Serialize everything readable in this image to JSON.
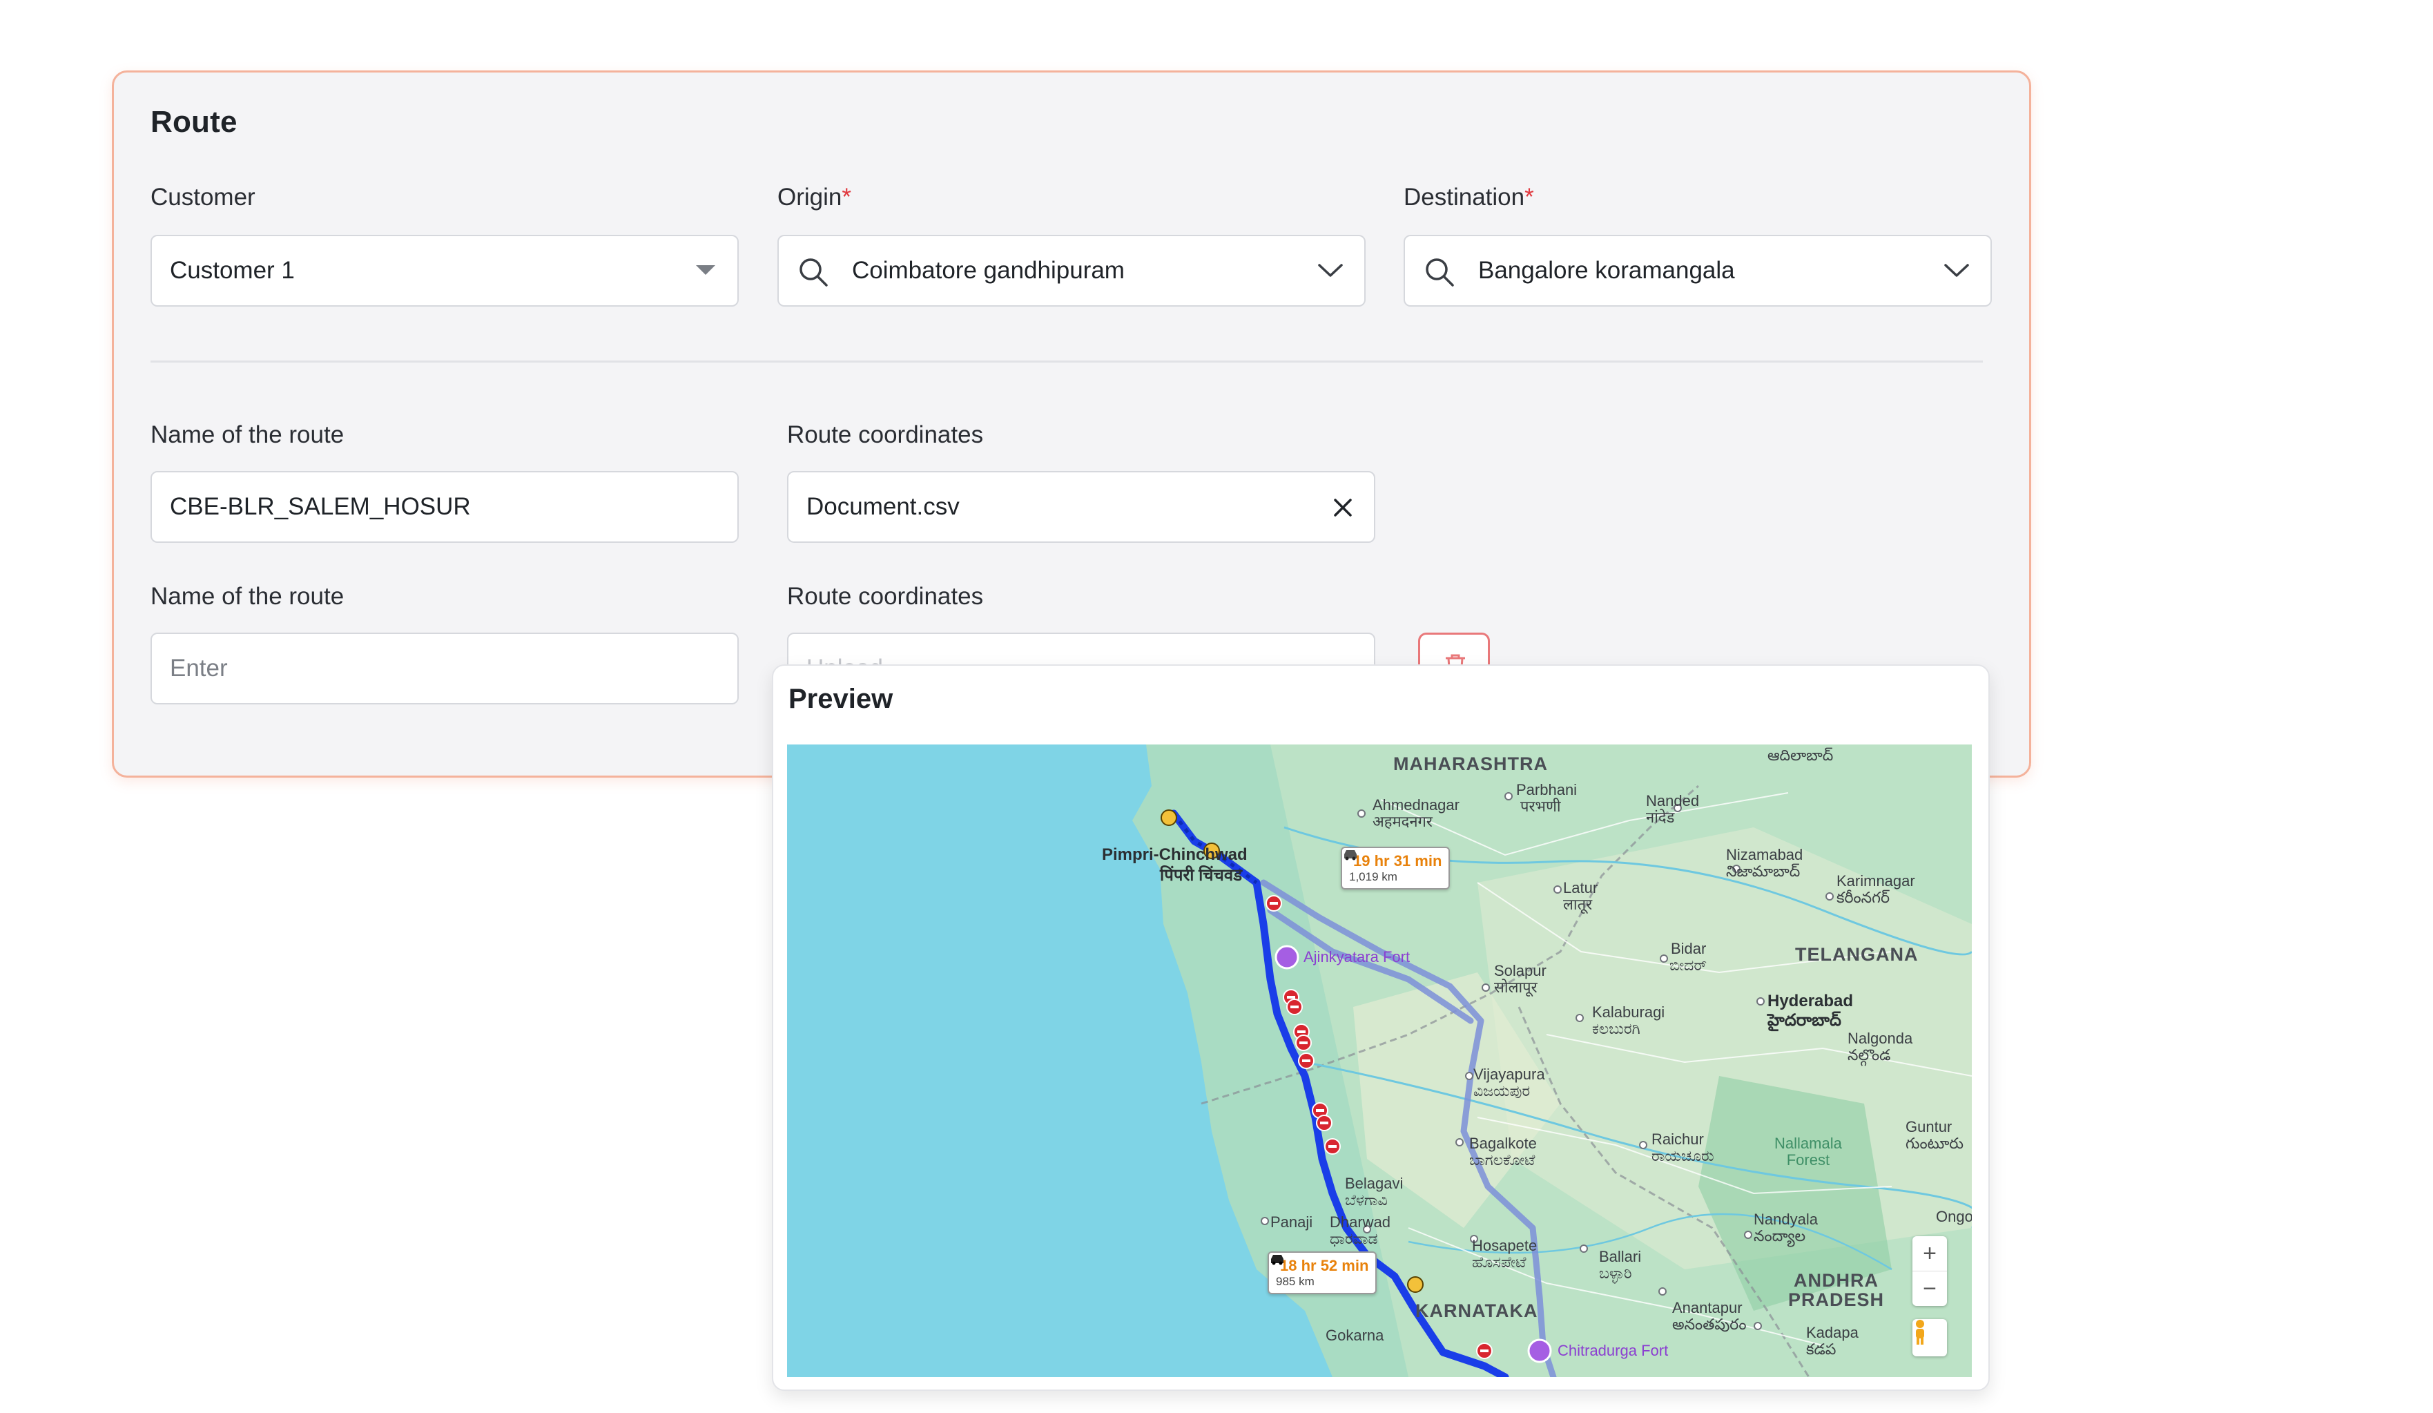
{
  "section_title": "Route",
  "customer": {
    "label": "Customer",
    "value": "Customer 1"
  },
  "origin": {
    "label": "Origin",
    "required_mark": "*",
    "value": "Coimbatore gandhipuram"
  },
  "destination": {
    "label": "Destination",
    "required_mark": "*",
    "value": "Bangalore koramangala"
  },
  "route_row_1": {
    "name_label": "Name of the route",
    "name_value": "CBE-BLR_SALEM_HOSUR",
    "coords_label": "Route coordinates",
    "coords_value": "Document.csv"
  },
  "route_row_2": {
    "name_label": "Name of the route",
    "name_placeholder": "Enter",
    "coords_label": "Route coordinates",
    "coords_placeholder": "Upload"
  },
  "preview": {
    "title": "Preview",
    "map": {
      "route_options": [
        {
          "time": "19 hr 31 min",
          "distance": "1,019 km"
        },
        {
          "time": "18 hr 52 min",
          "distance": "985 km"
        }
      ],
      "labels": {
        "maharashtra": "MAHARASHTRA",
        "karnataka": "KARNATAKA",
        "telangana": "TELANGANA",
        "andhra_pradesh": "ANDHRA\nPRADESH",
        "pimpri": "Pimpri-Chinchwad",
        "pimpri_local": "पिंपरी चिंचवड",
        "ahmednagar": "Ahmednagar",
        "ahmednagar_local": "अहमदनगर",
        "parbhani": "Parbhani",
        "parbhani_local": "परभणी",
        "nanded": "Nanded",
        "nanded_local": "नांदेड",
        "nizamabad": "Nizamabad",
        "nizamabad_local": "నిజామాబాద్",
        "karimnagar": "Karimnagar",
        "karimnagar_local": "కరీంనగర్",
        "latur": "Latur",
        "latur_local": "लातूर",
        "bidar": "Bidar",
        "bidar_local": "ಬೀದರ್",
        "solapur": "Solapur",
        "solapur_local": "सोलापूर",
        "kalaburagi": "Kalaburagi",
        "kalaburagi_local": "ಕಲಬುರಗಿ",
        "hyderabad": "Hyderabad",
        "hyderabad_local": "హైదరాబాద్",
        "nalgonda": "Nalgonda",
        "nalgonda_local": "నల్గొండ",
        "vijayapura": "Vijayapura",
        "vijayapura_local": "ವಿಜಯಪುರ",
        "bagalkote": "Bagalkote",
        "bagalkote_local": "ಬಾಗಲಕೋಟೆ",
        "raichur": "Raichur",
        "raichur_local": "ರಾಯಚೂರು",
        "nallamala": "Nallamala\nForest",
        "guntur": "Guntur",
        "guntur_local": "గుంటూరు",
        "belagavi": "Belagavi",
        "belagavi_local": "ಬೆಳಗಾವಿ",
        "panaji": "Panaji",
        "dharwad": "Dharwad",
        "dharwad_local": "ಧಾರವಾಡ",
        "hospete": "Hosapete",
        "hospete_local": "ಹೊಸಪೇಟೆ",
        "ballari": "Ballari",
        "ballari_local": "ಬಳ್ಳಾರಿ",
        "nandyala": "Nandyala",
        "nandyala_local": "నంద్యాల",
        "anantapur": "Anantapur",
        "anantapur_local": "అనంతపురం",
        "kadapa": "Kadapa",
        "kadapa_local": "కడప",
        "gokarna": "Gokarna",
        "ongole": "Ongo",
        "adilabad_local": "ఆదిలాబాద్",
        "ajinkyatara": "Ajinkyatara Fort",
        "chitradurga": "Chitradurga Fort"
      },
      "zoom_in": "+",
      "zoom_out": "−"
    }
  },
  "colors": {
    "card_border": "#f4b29b",
    "required": "#e0383e",
    "route_primary": "#1a3ee8",
    "route_alt": "#7d8fd8",
    "eta_time": "#e8820c",
    "poi": "#8b3fd1",
    "water": "#7fd4e6"
  },
  "icons": [
    "chevron-down-icon",
    "search-icon",
    "close-icon",
    "delete-icon",
    "car-icon",
    "zoom-in-icon",
    "zoom-out-icon",
    "pegman-icon",
    "fort-icon"
  ]
}
